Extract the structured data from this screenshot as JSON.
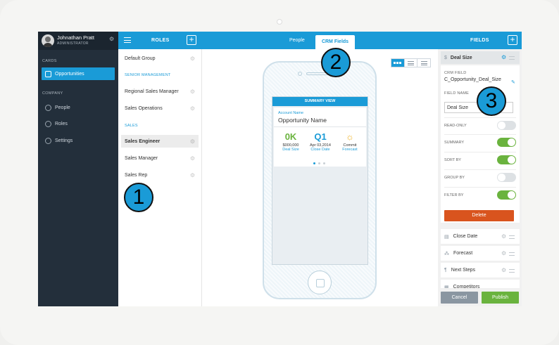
{
  "user": {
    "name": "Johnathan Pratt",
    "role": "ADMINISTRATOR"
  },
  "sidebar": {
    "cards_label": "CARDS",
    "company_label": "COMPANY",
    "items": [
      {
        "label": "Opportunities",
        "icon": "briefcase-icon",
        "active": true
      },
      {
        "label": "People",
        "icon": "person-icon"
      },
      {
        "label": "Roles",
        "icon": "roles-icon"
      },
      {
        "label": "Settings",
        "icon": "gear-icon"
      }
    ]
  },
  "roles": {
    "title": "ROLES",
    "default_group": "Default Group",
    "senior_label": "SENIOR MANAGEMENT",
    "senior_items": [
      "Regional Sales Manager",
      "Sales Operations"
    ],
    "sales_label": "SALES",
    "sales_items": [
      "Sales Engineer",
      "Sales Manager",
      "Sales Rep"
    ]
  },
  "tabs": {
    "people": "People",
    "crm_fields": "CRM Fields"
  },
  "preview": {
    "header": "SUMMARY VIEW",
    "account_label": "Account Name",
    "account_name": "Opportunity Name",
    "metrics": [
      {
        "big": "0K",
        "value": "$000,000",
        "label": "Deal Size",
        "color": "#6ab33e"
      },
      {
        "big": "Q1",
        "value": "Apr 03,2014",
        "label": "Close Date",
        "color": "#1a9bd7"
      },
      {
        "big": "☼",
        "value": "Commit",
        "label": "Forecast",
        "color": "#f0b429"
      }
    ]
  },
  "fields": {
    "title": "FIELDS",
    "selected": "Deal Size",
    "crm_field_label": "CRM FIELD",
    "crm_field_value": "C_Opportunity_Deal_Size",
    "field_name_label": "FIELD NAME",
    "field_name_value": "Deal Size",
    "toggles": [
      {
        "label": "READ-ONLY",
        "on": false
      },
      {
        "label": "SUMMARY",
        "on": true
      },
      {
        "label": "SORT BY",
        "on": true
      },
      {
        "label": "GROUP BY",
        "on": false
      },
      {
        "label": "FILTER BY",
        "on": true
      }
    ],
    "delete_label": "Delete",
    "other_fields": [
      "Close Date",
      "Forecast",
      "Next Steps",
      "Competitors"
    ],
    "cancel_label": "Cancel",
    "publish_label": "Publish"
  },
  "callouts": [
    "1",
    "2",
    "3"
  ],
  "colors": {
    "accent": "#1a9bd7",
    "green": "#6ab33e",
    "danger": "#d9541e",
    "sidebar": "#232f3b"
  }
}
